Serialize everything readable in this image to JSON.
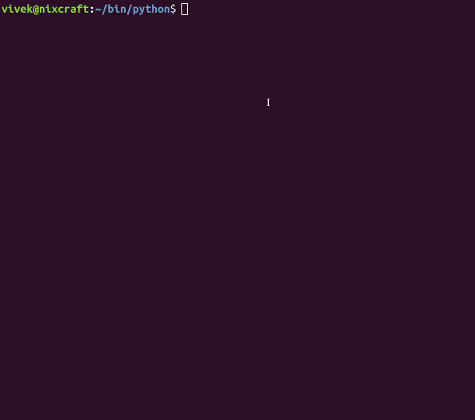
{
  "prompt": {
    "user_host": "vivek@nixcraft",
    "separator": ":",
    "path": "~/bin/python",
    "symbol": "$"
  },
  "cursor": {
    "text_caret": "I"
  }
}
